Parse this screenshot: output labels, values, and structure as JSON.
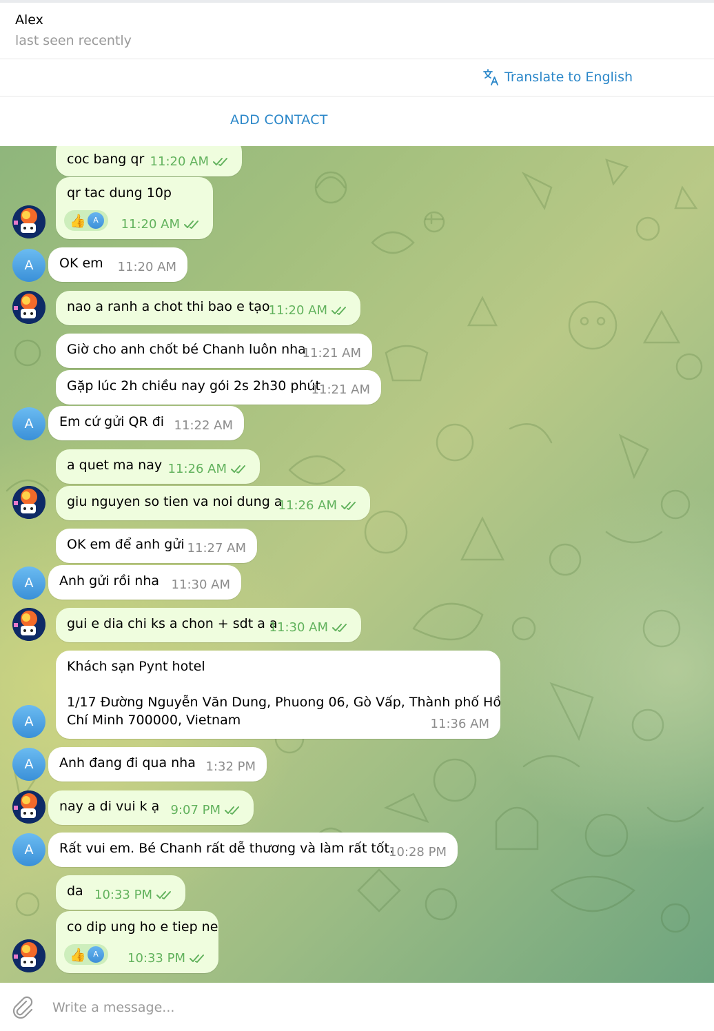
{
  "header": {
    "name": "Alex",
    "status": "last seen recently"
  },
  "translate": {
    "label": "Translate to English",
    "icon": "translate-icon"
  },
  "add_contact": {
    "label": "ADD CONTACT"
  },
  "messages": [
    {
      "dir": "out",
      "text": "coc bang qr",
      "time": "11:20 AM",
      "read": true
    },
    {
      "dir": "out",
      "text": "qr tac dung 10p",
      "time": "11:20 AM",
      "read": true,
      "reaction": {
        "emoji": "👍",
        "by": "A"
      }
    },
    {
      "dir": "in",
      "text": "OK em",
      "time": "11:20 AM"
    },
    {
      "dir": "out",
      "text": "nao a ranh a chot thi bao e tạo",
      "time": "11:20 AM",
      "read": true
    },
    {
      "dir": "in",
      "text": "Giờ cho anh chốt bé Chanh luôn nha",
      "time": "11:21 AM"
    },
    {
      "dir": "in",
      "text": "Gặp lúc 2h chiều nay gói 2s 2h30 phút",
      "time": "11:21 AM"
    },
    {
      "dir": "in",
      "text": "Em cứ gửi QR đi",
      "time": "11:22 AM"
    },
    {
      "dir": "out",
      "text": "a quet ma nay",
      "time": "11:26 AM",
      "read": true
    },
    {
      "dir": "out",
      "text": "giu nguyen so tien va noi dung a",
      "time": "11:26 AM",
      "read": true
    },
    {
      "dir": "in",
      "text": "OK em để anh gửi",
      "time": "11:27 AM"
    },
    {
      "dir": "in",
      "text": "Anh gửi rồi nha",
      "time": "11:30 AM"
    },
    {
      "dir": "out",
      "text": "gui e dia chi ks a chon + sdt a a",
      "time": "11:30 AM",
      "read": true
    },
    {
      "dir": "in",
      "lines": [
        "Khách sạn Pynt hotel",
        "",
        "1/17 Đường Nguyễn Văn Dung, Phuong 06, Gò Vấp, Thành phố Hồ",
        "Chí Minh 700000, Vietnam"
      ],
      "time": "11:36 AM"
    },
    {
      "dir": "in",
      "text": "Anh đang đi qua nha",
      "time": "1:32 PM"
    },
    {
      "dir": "out",
      "text": "nay a di vui k ạ",
      "time": "9:07 PM",
      "read": true
    },
    {
      "dir": "in",
      "text": "Rất vui em. Bé Chanh rất dễ thương và làm rất tốt.",
      "time": "10:28 PM"
    },
    {
      "dir": "out",
      "text": "da",
      "time": "10:33 PM",
      "read": true
    },
    {
      "dir": "out",
      "text": "co dip ung ho e tiep ne",
      "time": "10:33 PM",
      "read": true,
      "reaction": {
        "emoji": "👍",
        "by": "A"
      }
    }
  ],
  "avatar_letter": "A",
  "composer": {
    "placeholder": "Write a message...",
    "attach_icon": "paperclip-icon"
  },
  "colors": {
    "accent": "#2b87c9",
    "outgoing_bubble": "#effdde",
    "incoming_bubble": "#ffffff",
    "read_check": "#62b25d"
  }
}
